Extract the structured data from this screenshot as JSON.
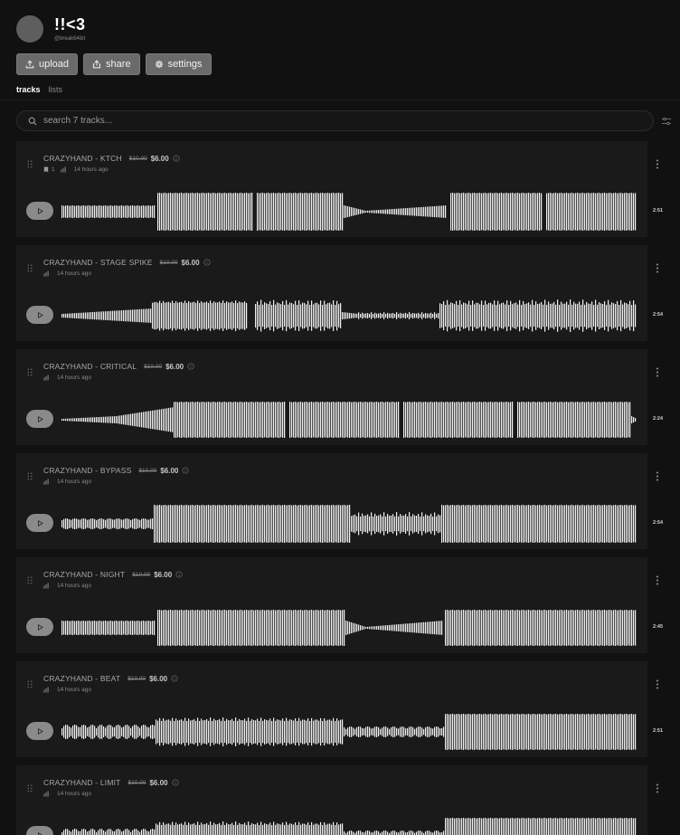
{
  "profile": {
    "name": "!!<3",
    "handle": "@break64bit"
  },
  "actions": {
    "upload_label": "upload",
    "share_label": "share",
    "settings_label": "settings"
  },
  "tabs": {
    "active_label": "tracks",
    "other_label": "lists"
  },
  "search": {
    "placeholder": "search 7 tracks..."
  },
  "tracks": [
    {
      "title": "CRAZYHAND - KTCH",
      "price_old": "$10.00",
      "price_new": "$6.00",
      "bookmarks": "1",
      "time_ago": "14 hours ago",
      "duration": "2:51",
      "pattern": "ktch"
    },
    {
      "title": "CRAZYHAND - STAGE SPIKE",
      "price_old": "$10.00",
      "price_new": "$6.00",
      "time_ago": "14 hours ago",
      "duration": "2:54",
      "pattern": "spike"
    },
    {
      "title": "CRAZYHAND - CRITICAL",
      "price_old": "$10.00",
      "price_new": "$6.00",
      "time_ago": "14 hours ago",
      "duration": "2:24",
      "pattern": "critical"
    },
    {
      "title": "CRAZYHAND - BYPASS",
      "price_old": "$10.00",
      "price_new": "$6.00",
      "time_ago": "14 hours ago",
      "duration": "2:54",
      "pattern": "bypass"
    },
    {
      "title": "CRAZYHAND - NIGHT",
      "price_old": "$10.00",
      "price_new": "$6.00",
      "time_ago": "14 hours ago",
      "duration": "2:45",
      "pattern": "night"
    },
    {
      "title": "CRAZYHAND - BEAT",
      "price_old": "$10.00",
      "price_new": "$6.00",
      "time_ago": "14 hours ago",
      "duration": "2:51",
      "pattern": "beat"
    },
    {
      "title": "CRAZYHAND - LIMIT",
      "price_old": "$10.00",
      "price_new": "$6.00",
      "time_ago": "14 hours ago",
      "duration": "",
      "pattern": "limit"
    }
  ],
  "icons": {
    "upload": "upload-icon",
    "share": "share-icon",
    "settings": "gear-icon",
    "search": "search-icon",
    "filter": "sliders-icon",
    "drag": "drag-handle-icon",
    "info": "info-icon",
    "bookmark": "bookmark-icon",
    "stats": "bar-chart-icon",
    "menu": "more-vertical-icon",
    "play": "play-icon"
  },
  "colors": {
    "background": "#111111",
    "card": "#1a1a1a",
    "button": "#6a6a6a",
    "waveform": "#f2f2f2",
    "play_button": "#8a8a8a"
  }
}
